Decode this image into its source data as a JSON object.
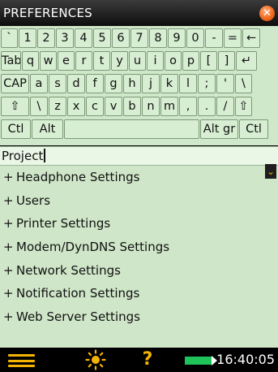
{
  "window": {
    "title": "PREFERENCES",
    "close_glyph": "✕"
  },
  "keyboard": {
    "row1": [
      "`",
      "1",
      "2",
      "3",
      "4",
      "5",
      "6",
      "7",
      "8",
      "9",
      "0",
      "-",
      "=",
      "←"
    ],
    "row2": [
      "Tab",
      "q",
      "w",
      "e",
      "r",
      "t",
      "y",
      "u",
      "i",
      "o",
      "p",
      "[",
      "]",
      "↵"
    ],
    "row3": [
      "CAP",
      "a",
      "s",
      "d",
      "f",
      "g",
      "h",
      "j",
      "k",
      "l",
      ";",
      "'",
      "\\"
    ],
    "row4": [
      "⇧",
      "\\",
      "z",
      "x",
      "c",
      "v",
      "b",
      "n",
      "m",
      ",",
      ".",
      "/",
      "⇧"
    ],
    "row5": [
      "Ctl",
      "Alt",
      "",
      "Alt gr",
      "Ctl"
    ]
  },
  "project": {
    "value": "Project"
  },
  "settings": {
    "items": [
      {
        "icon": "+",
        "label": "Headphone Settings"
      },
      {
        "icon": "+",
        "label": "Users"
      },
      {
        "icon": "+",
        "label": "Printer Settings"
      },
      {
        "icon": "+",
        "label": "Modem/DynDNS Settings"
      },
      {
        "icon": "+",
        "label": "Network Settings"
      },
      {
        "icon": "+",
        "label": "Notification Settings"
      },
      {
        "icon": "+",
        "label": "Web Server Settings"
      }
    ],
    "scroll_glyph": "⌄"
  },
  "statusbar": {
    "menu_icon": "hamburger-icon",
    "brightness_icon": "sun-icon",
    "help_glyph": "?",
    "battery_icon": "battery-icon",
    "time": "16:40:05"
  },
  "colors": {
    "accent": "#f3b300",
    "panel_bg": "#cfe6c8",
    "battery_fill": "#1ec45a"
  }
}
